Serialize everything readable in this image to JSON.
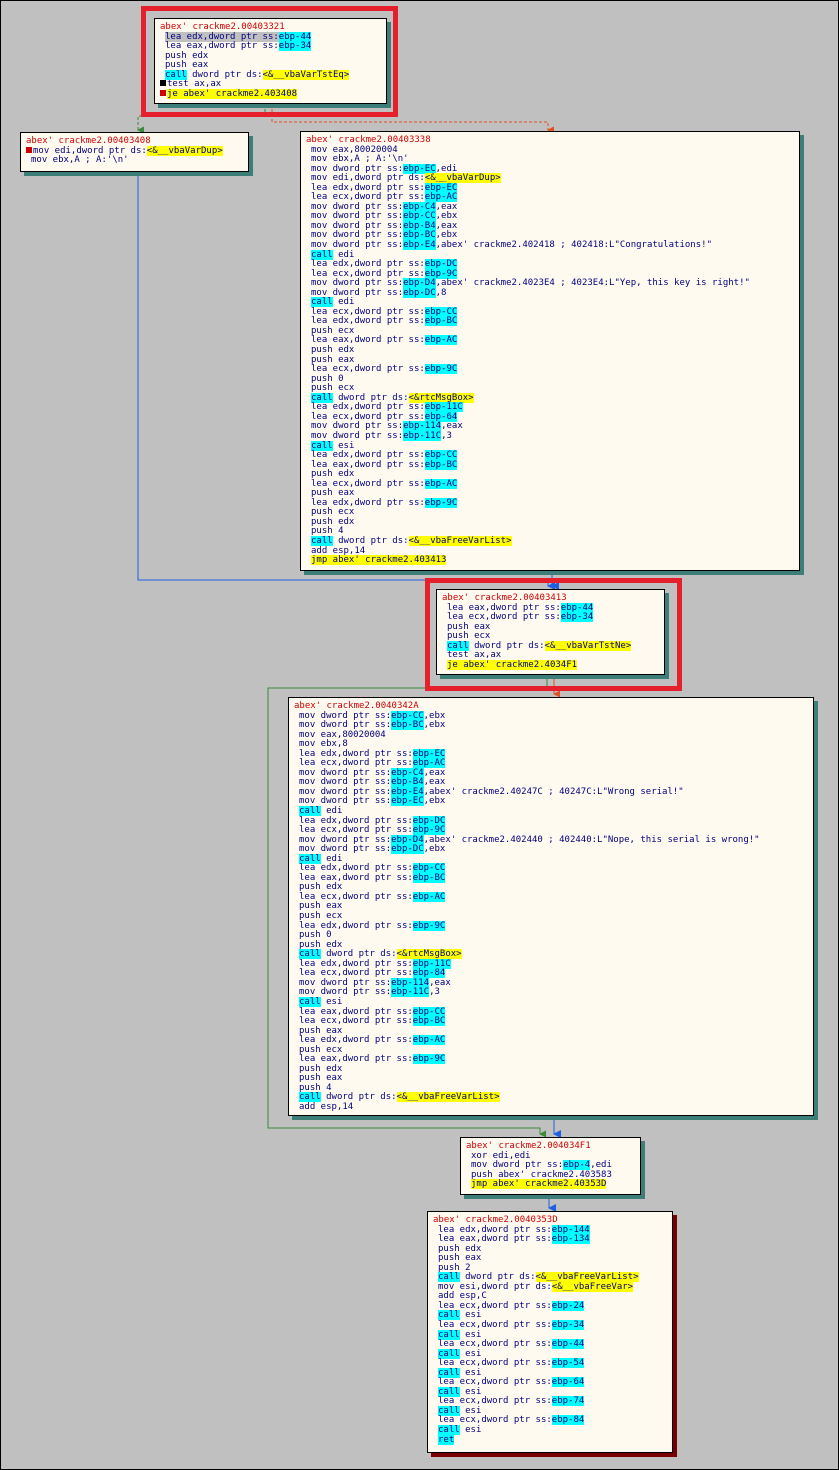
{
  "colors": {
    "node_bg": "#fffaf0",
    "title": "#d00000",
    "mnemonic": "#000080",
    "operand_highlight": "#00ffff",
    "label_highlight": "#ffff00",
    "edge_green": "#3a8a3a",
    "edge_red": "#e05020",
    "edge_blue": "#2060e0",
    "highlight_box": "#e5202c"
  },
  "nodes": [
    {
      "id": "n1",
      "title": "abex' crackme2.00403321",
      "lines": [
        "[[sel:lea edx,dword ptr ss:{{ebp-44}}]]",
        "lea eax,dword ptr ss:{{ebp-34}}",
        "push edx",
        "push eax",
        "{{call}} dword ptr ds:[[<&__vbaVarTstEq>]]",
        "#test ax,ax",
        "#[[je abex' crackme2.403408]]"
      ]
    },
    {
      "id": "n2",
      "title": "abex' crackme2.00403408",
      "lines": [
        "#mov edi,dword ptr ds:[[<&__vbaVarDup>]]",
        "mov ebx,A ; A:'\\n'"
      ]
    },
    {
      "id": "n3",
      "title": "abex' crackme2.00403338",
      "lines": [
        "mov eax,80020004",
        "mov ebx,A ; A:'\\n'",
        "mov dword ptr ss:{{ebp-EC}},edi",
        "mov edi,dword ptr ds:[[<&__vbaVarDup>]]",
        "lea edx,dword ptr ss:{{ebp-EC}}",
        "lea ecx,dword ptr ss:{{ebp-AC}}",
        "mov dword ptr ss:{{ebp-C4}},eax",
        "mov dword ptr ss:{{ebp-CC}},ebx",
        "mov dword ptr ss:{{ebp-B4}},eax",
        "mov dword ptr ss:{{ebp-BC}},ebx",
        "mov dword ptr ss:{{ebp-E4}},abex' crackme2.402418 ; 402418:L\"Congratulations!\"",
        "{{call}} edi",
        "lea edx,dword ptr ss:{{ebp-DC}}",
        "lea ecx,dword ptr ss:{{ebp-9C}}",
        "mov dword ptr ss:{{ebp-D4}},abex' crackme2.4023E4 ; 4023E4:L\"Yep, this key is right!\"",
        "mov dword ptr ss:{{ebp-DC}},8",
        "{{call}} edi",
        "lea ecx,dword ptr ss:{{ebp-CC}}",
        "lea edx,dword ptr ss:{{ebp-BC}}",
        "push ecx",
        "lea eax,dword ptr ss:{{ebp-AC}}",
        "push edx",
        "push eax",
        "lea ecx,dword ptr ss:{{ebp-9C}}",
        "push 0",
        "push ecx",
        "{{call}} dword ptr ds:[[<&rtcMsgBox>]]",
        "lea edx,dword ptr ss:{{ebp-11C}}",
        "lea ecx,dword ptr ss:{{ebp-64}}",
        "mov dword ptr ss:{{ebp-114}},eax",
        "mov dword ptr ss:{{ebp-11C}},3",
        "{{call}} esi",
        "lea edx,dword ptr ss:{{ebp-CC}}",
        "lea eax,dword ptr ss:{{ebp-BC}}",
        "push edx",
        "lea ecx,dword ptr ss:{{ebp-AC}}",
        "push eax",
        "lea edx,dword ptr ss:{{ebp-9C}}",
        "push ecx",
        "push edx",
        "push 4",
        "{{call}} dword ptr ds:[[<&__vbaFreeVarList>]]",
        "add esp,14",
        "[[jmp abex' crackme2.403413]]"
      ]
    },
    {
      "id": "n4",
      "title": "abex' crackme2.00403413",
      "lines": [
        "lea eax,dword ptr ss:{{ebp-44}}",
        "lea ecx,dword ptr ss:{{ebp-34}}",
        "push eax",
        "push ecx",
        "{{call}} dword ptr ds:[[<&__vbaVarTstNe>]]",
        "test ax,ax",
        "[[je abex' crackme2.4034F1]]"
      ]
    },
    {
      "id": "n5",
      "title": "abex' crackme2.0040342A",
      "lines": [
        "mov dword ptr ss:{{ebp-CC}},ebx",
        "mov dword ptr ss:{{ebp-BC}},ebx",
        "mov eax,80020004",
        "mov ebx,8",
        "lea edx,dword ptr ss:{{ebp-EC}}",
        "lea ecx,dword ptr ss:{{ebp-AC}}",
        "mov dword ptr ss:{{ebp-C4}},eax",
        "mov dword ptr ss:{{ebp-B4}},eax",
        "mov dword ptr ss:{{ebp-E4}},abex' crackme2.40247C ; 40247C:L\"Wrong serial!\"",
        "mov dword ptr ss:{{ebp-EC}},ebx",
        "{{call}} edi",
        "lea edx,dword ptr ss:{{ebp-DC}}",
        "lea ecx,dword ptr ss:{{ebp-9C}}",
        "mov dword ptr ss:{{ebp-D4}},abex' crackme2.402440 ; 402440:L\"Nope, this serial is wrong!\"",
        "mov dword ptr ss:{{ebp-DC}},ebx",
        "{{call}} edi",
        "lea edx,dword ptr ss:{{ebp-CC}}",
        "lea eax,dword ptr ss:{{ebp-BC}}",
        "push edx",
        "lea ecx,dword ptr ss:{{ebp-AC}}",
        "push eax",
        "push ecx",
        "lea edx,dword ptr ss:{{ebp-9C}}",
        "push 0",
        "push edx",
        "{{call}} dword ptr ds:[[<&rtcMsgBox>]]",
        "lea edx,dword ptr ss:{{ebp-11C}}",
        "lea ecx,dword ptr ss:{{ebp-84}}",
        "mov dword ptr ss:{{ebp-114}},eax",
        "mov dword ptr ss:{{ebp-11C}},3",
        "{{call}} esi",
        "lea eax,dword ptr ss:{{ebp-CC}}",
        "lea ecx,dword ptr ss:{{ebp-BC}}",
        "push eax",
        "lea edx,dword ptr ss:{{ebp-AC}}",
        "push ecx",
        "lea eax,dword ptr ss:{{ebp-9C}}",
        "push edx",
        "push eax",
        "push 4",
        "{{call}} dword ptr ds:[[<&__vbaFreeVarList>]]",
        "add esp,14"
      ]
    },
    {
      "id": "n6",
      "title": "abex' crackme2.004034F1",
      "lines": [
        "xor edi,edi",
        "mov dword ptr ss:{{ebp-4}},edi",
        "push abex' crackme2.403583",
        "[[jmp abex' crackme2.40353D]]"
      ]
    },
    {
      "id": "n7",
      "title": "abex' crackme2.0040353D",
      "lines": [
        "lea edx,dword ptr ss:{{ebp-144}}",
        "lea eax,dword ptr ss:{{ebp-134}}",
        "push edx",
        "push eax",
        "push 2",
        "{{call}} dword ptr ds:[[<&__vbaFreeVarList>]]",
        "mov esi,dword ptr ds:[[<&__vbaFreeVar>]]",
        "add esp,C",
        "lea ecx,dword ptr ss:{{ebp-24}}",
        "{{call}} esi",
        "lea ecx,dword ptr ss:{{ebp-34}}",
        "{{call}} esi",
        "lea ecx,dword ptr ss:{{ebp-44}}",
        "{{call}} esi",
        "lea ecx,dword ptr ss:{{ebp-54}}",
        "{{call}} esi",
        "lea ecx,dword ptr ss:{{ebp-64}}",
        "{{call}} esi",
        "lea ecx,dword ptr ss:{{ebp-74}}",
        "{{call}} esi",
        "lea ecx,dword ptr ss:{{ebp-84}}",
        "{{call}} esi",
        "{{ret}}"
      ]
    }
  ]
}
